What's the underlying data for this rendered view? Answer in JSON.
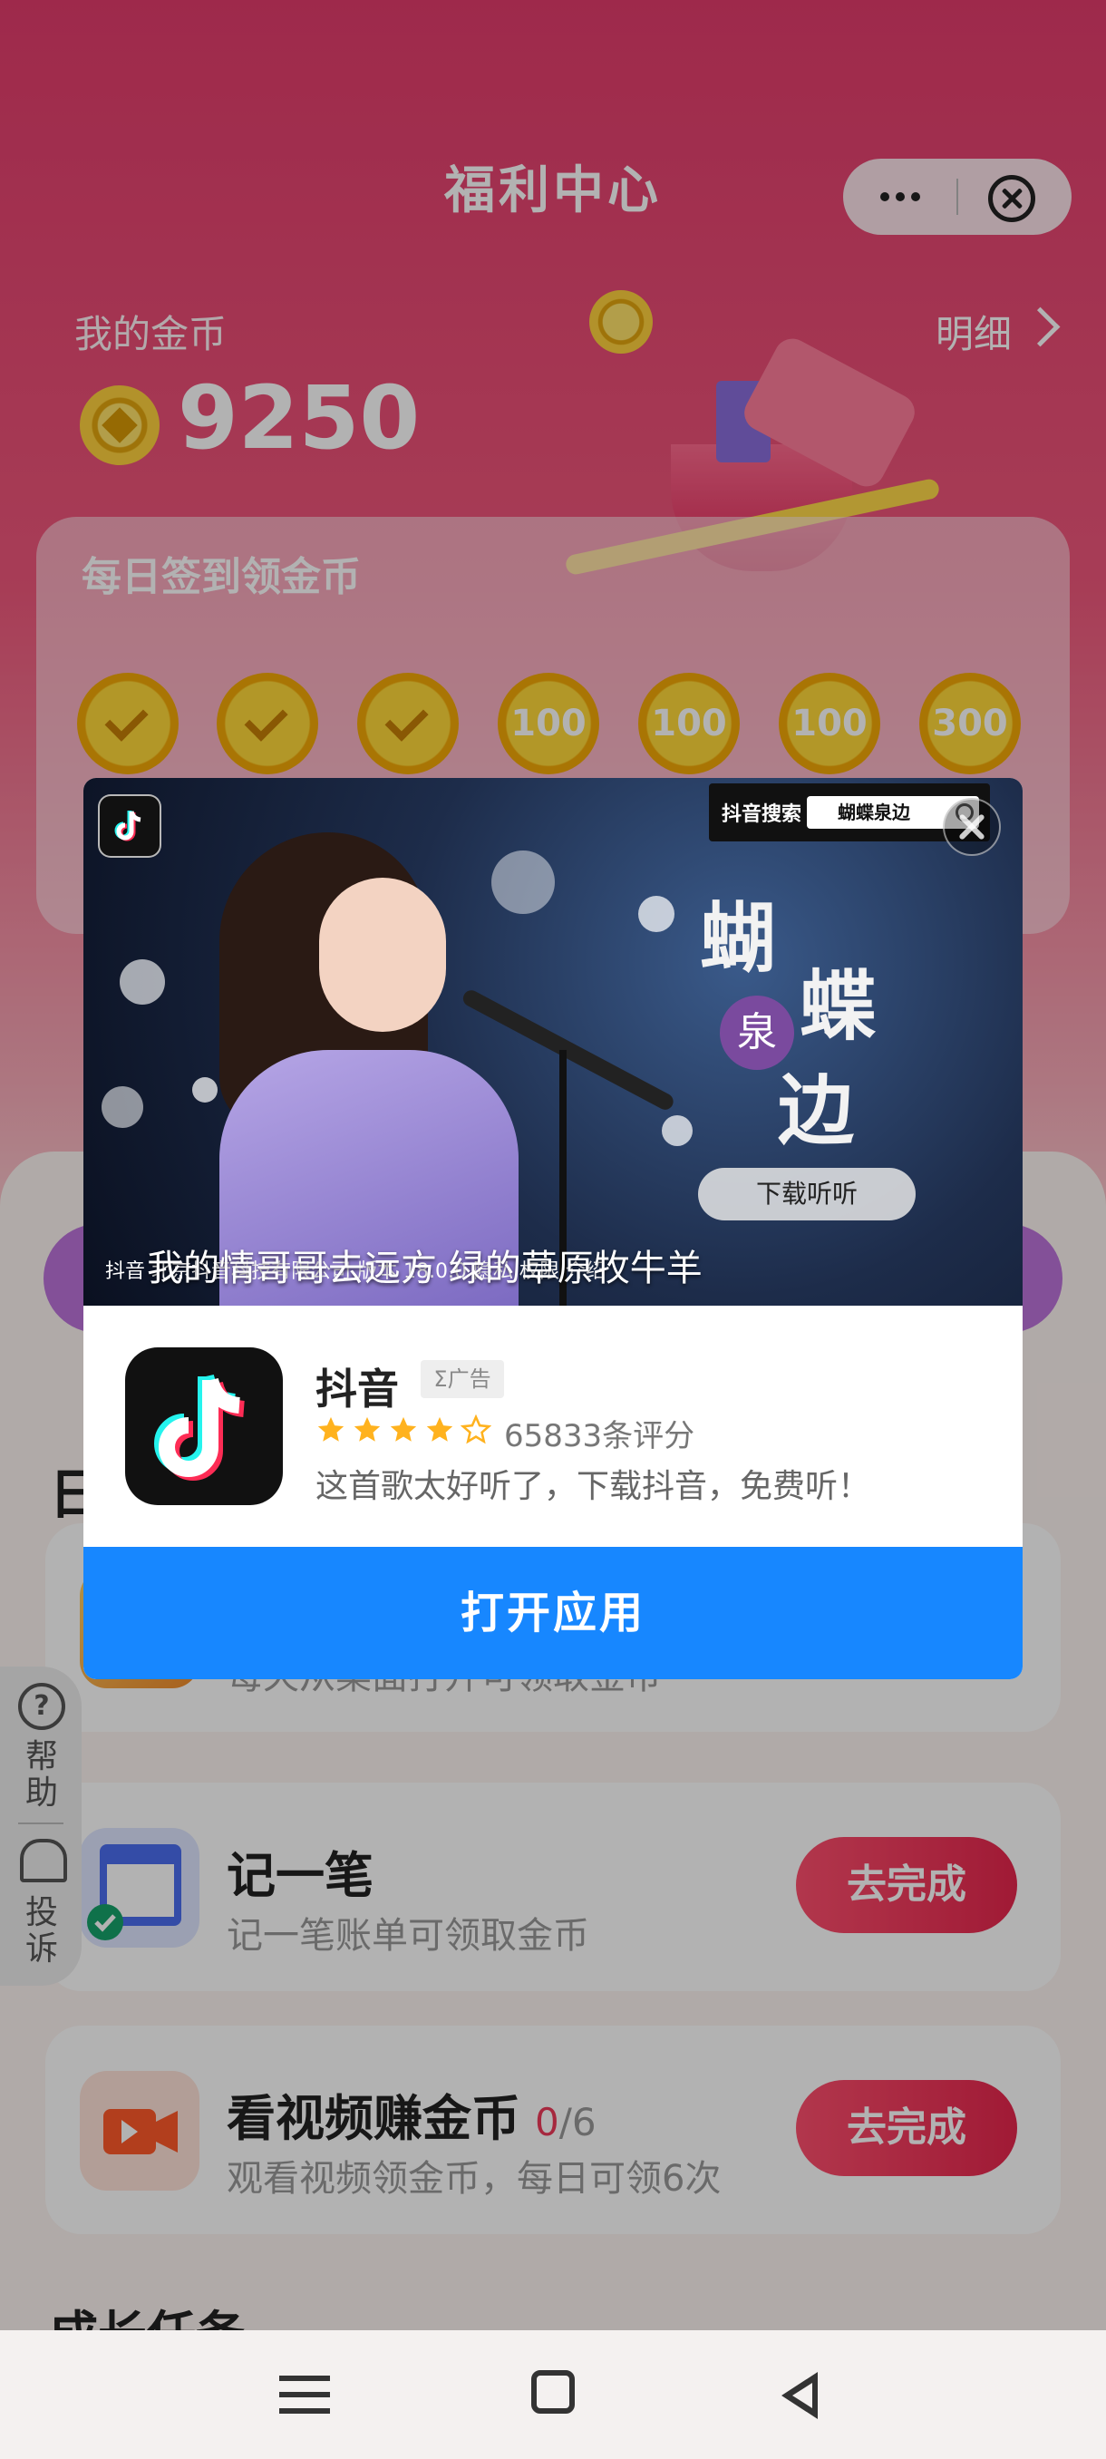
{
  "header": {
    "title": "福利中心"
  },
  "coins": {
    "label": "我的金币",
    "value": "9250",
    "detail_label": "明细"
  },
  "signin": {
    "title": "每日签到领金币",
    "days": [
      {
        "state": "done",
        "label": ""
      },
      {
        "state": "done",
        "label": ""
      },
      {
        "state": "done",
        "label": ""
      },
      {
        "state": "todo",
        "label": "100"
      },
      {
        "state": "todo",
        "label": "100"
      },
      {
        "state": "todo",
        "label": "100"
      },
      {
        "state": "todo",
        "label": "300"
      }
    ]
  },
  "section_fragment": "日",
  "tasks": [
    {
      "name": "",
      "desc": "每天从桌面打开可领取金币",
      "button": ""
    },
    {
      "name": "记一笔",
      "desc": "记一笔账单可领取金币",
      "button": "去完成"
    },
    {
      "name": "看视频赚金币",
      "progress_current": "0",
      "progress_total": "/6",
      "desc": "观看视频领金币，每日可领6次",
      "button": "去完成"
    }
  ],
  "growth_title": "成长任务",
  "sidebar": {
    "help": "帮助",
    "report": "投诉"
  },
  "ad": {
    "search_label": "抖音搜索",
    "search_query": "蝴蝶泉边",
    "song_chars": {
      "c1": "蝴",
      "c2": "蝶",
      "c3": "泉",
      "c4": "边"
    },
    "listen_button": "下载听听",
    "lyric": "我的情哥哥去远方 绿的草原牧牛羊",
    "disclaimer": "抖音 北京抖音科技有限公司 版本 18.0.0 隐私 权限 介绍",
    "app_name": "抖音",
    "ad_badge": "Σ广告",
    "rating_stars": 4,
    "rating_max": 5,
    "rating_text": "65833条评分",
    "description": "这首歌太好听了，下载抖音，免费听！",
    "open_button": "打开应用"
  },
  "colors": {
    "accent": "#1787ff",
    "brand_red": "#e6264d",
    "coin_gold": "#ffd93a"
  },
  "icons": {
    "capsule_more": "more-dots-icon",
    "capsule_close": "close-circle-icon",
    "coin": "coin-icon",
    "ad_close": "close-icon",
    "star": "star-icon",
    "nav": [
      "menu-icon",
      "home-square-icon",
      "back-triangle-icon"
    ]
  }
}
